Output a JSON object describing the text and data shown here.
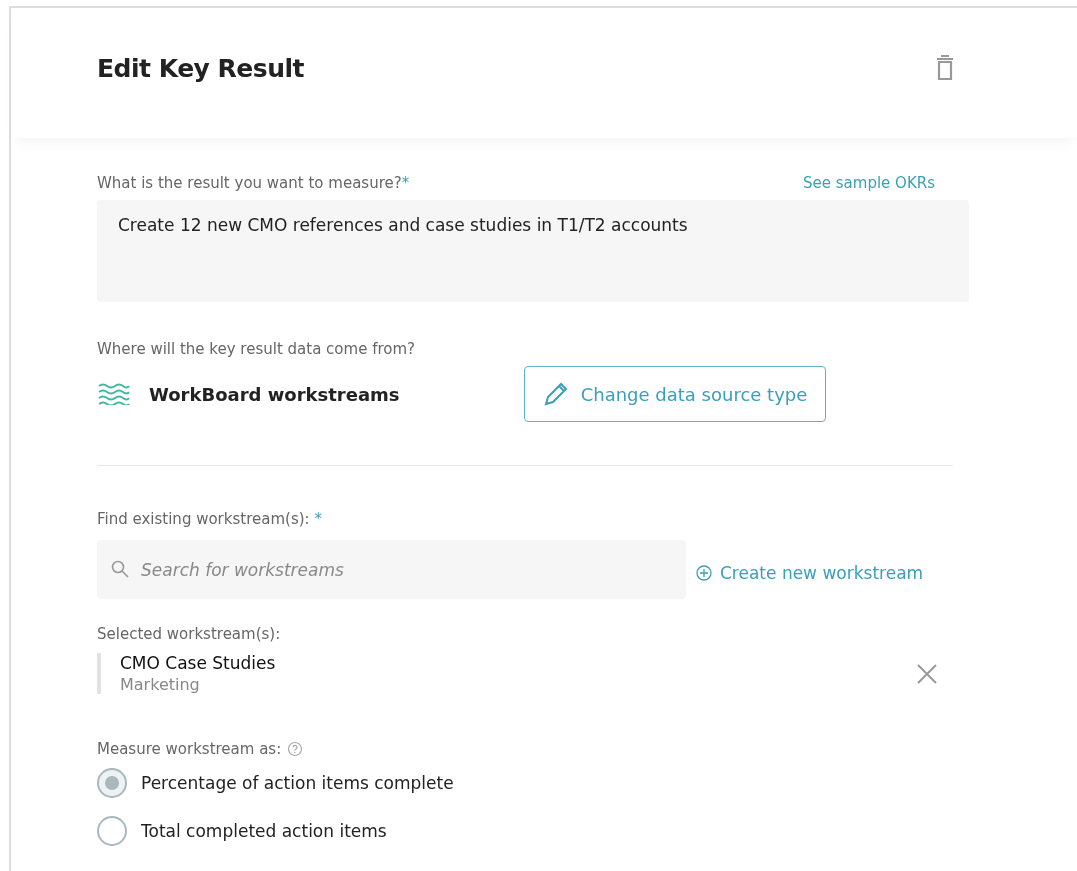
{
  "header": {
    "title": "Edit Key Result"
  },
  "result": {
    "label": "What is the result you want to measure?",
    "required_mark": "*",
    "sample_link": "See sample OKRs",
    "value": "Create 12 new CMO references and case studies in T1/T2 accounts"
  },
  "data_source": {
    "label": "Where will the key result data come from?",
    "name": "WorkBoard workstreams",
    "change_button": "Change data source type"
  },
  "find": {
    "label": "Find existing workstream(s):",
    "required_mark": "*",
    "placeholder": "Search for workstreams",
    "create_link": "Create new workstream"
  },
  "selected": {
    "label": "Selected workstream(s):",
    "items": [
      {
        "name": "CMO Case Studies",
        "team": "Marketing"
      }
    ]
  },
  "measure": {
    "label": "Measure workstream as:",
    "options": [
      {
        "label": "Percentage of action items complete",
        "selected": true
      },
      {
        "label": "Total completed action items",
        "selected": false
      }
    ]
  }
}
